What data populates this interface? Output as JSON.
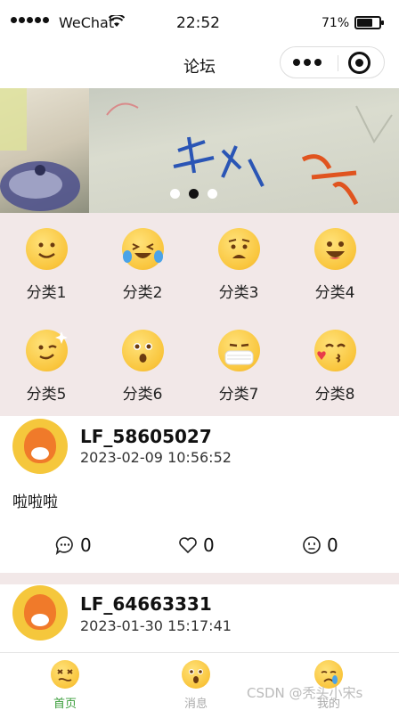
{
  "status_bar": {
    "carrier": "WeChat",
    "time": "22:52",
    "battery_percent_text": "71%",
    "battery_level": 0.71
  },
  "nav": {
    "title": "论坛"
  },
  "banner": {
    "slide_count": 3,
    "active_index": 1
  },
  "categories": [
    {
      "label": "分类1",
      "icon": "smile-emoji-icon"
    },
    {
      "label": "分类2",
      "icon": "laugh-tears-emoji-icon"
    },
    {
      "label": "分类3",
      "icon": "worried-emoji-icon"
    },
    {
      "label": "分类4",
      "icon": "grin-emoji-icon"
    },
    {
      "label": "分类5",
      "icon": "wink-emoji-icon"
    },
    {
      "label": "分类6",
      "icon": "surprised-emoji-icon"
    },
    {
      "label": "分类7",
      "icon": "mask-emoji-icon"
    },
    {
      "label": "分类8",
      "icon": "kiss-emoji-icon"
    }
  ],
  "posts": [
    {
      "username": "LF_58605027",
      "datetime": "2023-02-09 10:56:52",
      "content": "啦啦啦",
      "comment_count": "0",
      "like_count": "0",
      "reaction_count": "0"
    },
    {
      "username": "LF_64663331",
      "datetime": "2023-01-30 15:17:41"
    }
  ],
  "tabbar": {
    "tabs": [
      {
        "label": "首页",
        "icon": "dizzy-emoji-icon",
        "active": true
      },
      {
        "label": "消息",
        "icon": "surprised-emoji-icon",
        "active": false
      },
      {
        "label": "我的",
        "icon": "crying-emoji-icon",
        "active": false
      }
    ],
    "active_color": "#3a9d3a"
  },
  "watermark": "CSDN @秃头小宋s",
  "colors": {
    "grid_background": "#f2e8e8",
    "emoji_yellow": "#f9c53c"
  }
}
